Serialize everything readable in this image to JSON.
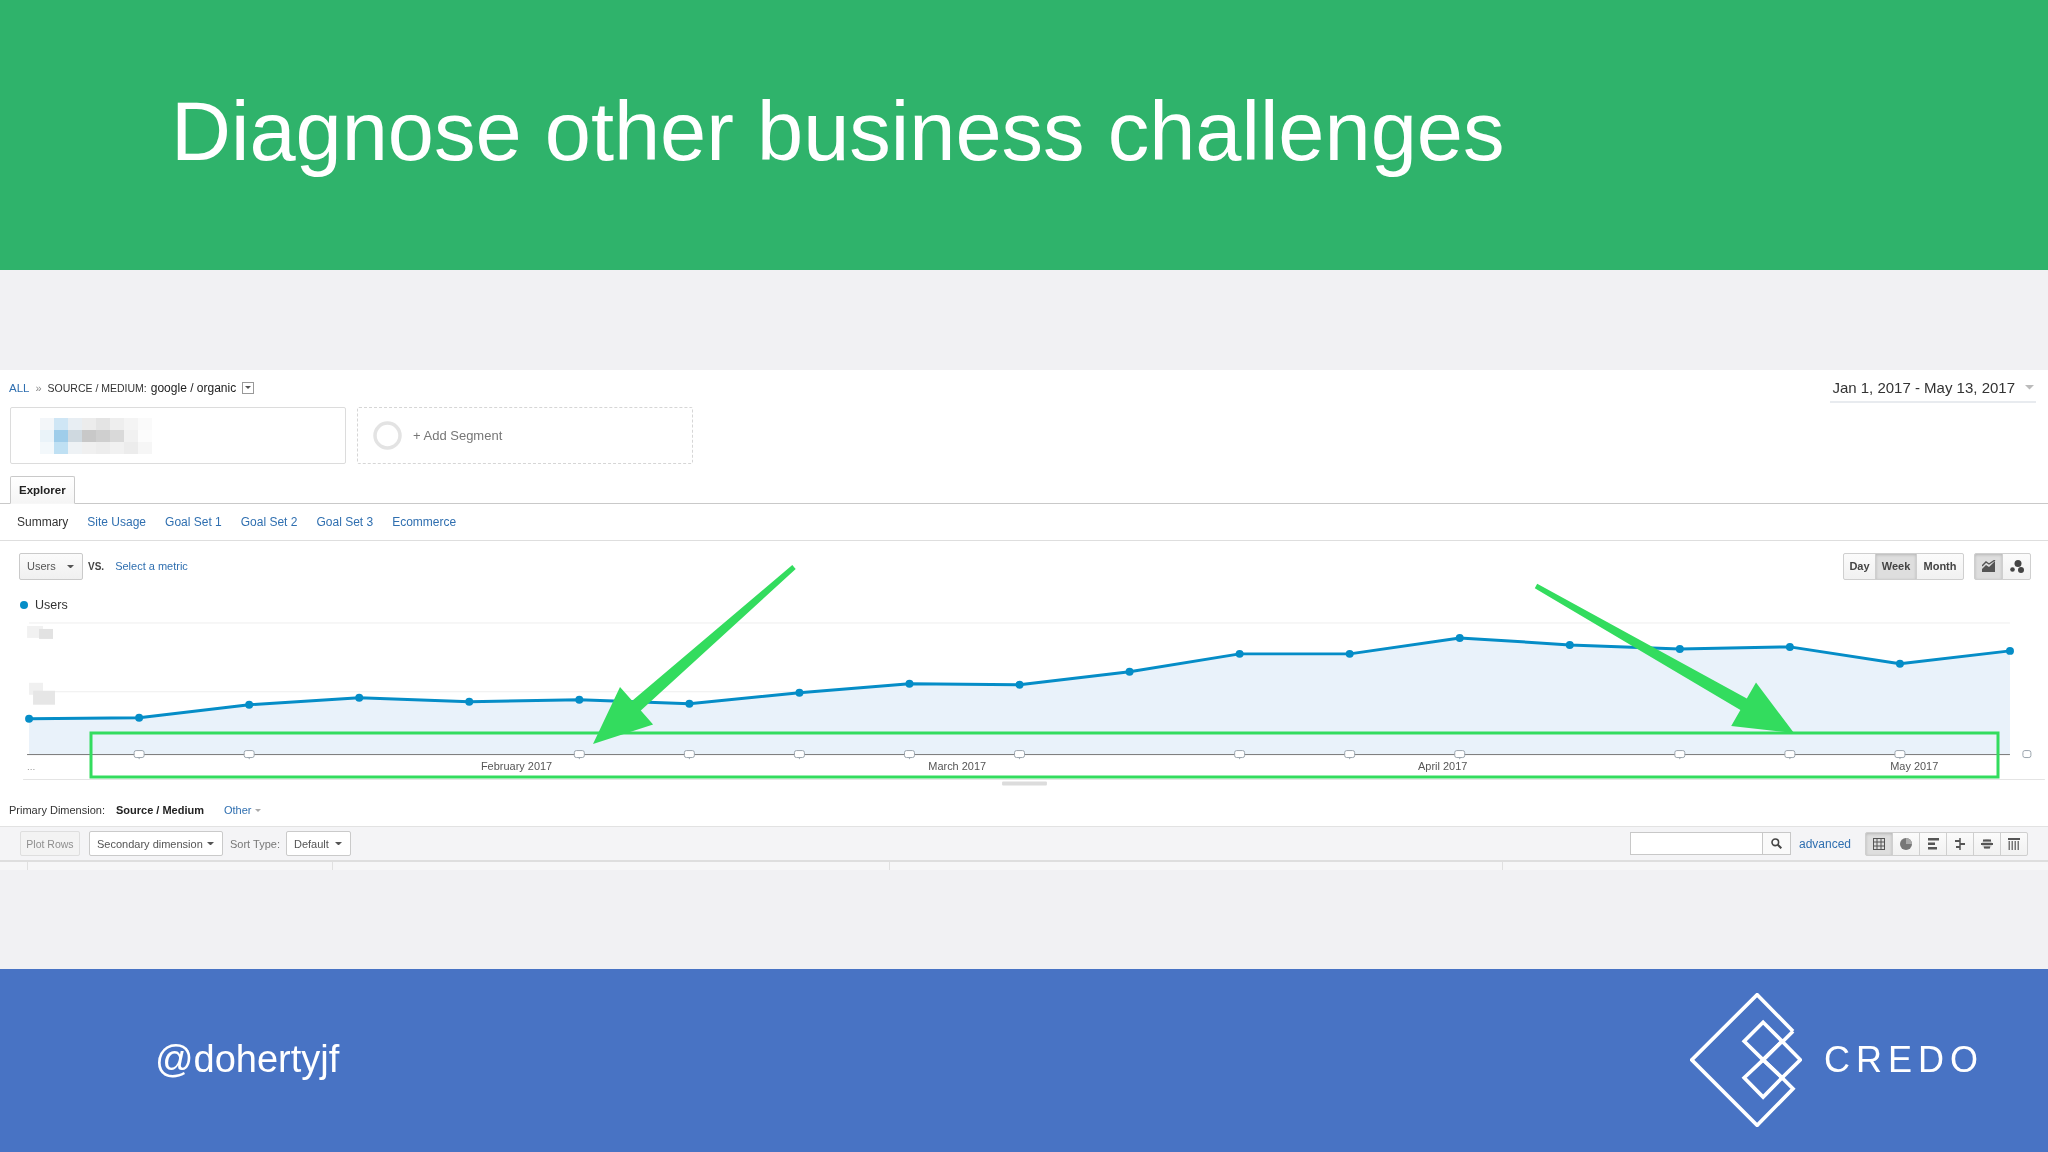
{
  "slide": {
    "title": "Diagnose other business challenges"
  },
  "report": {
    "breadcrumb": {
      "root": "ALL",
      "separator": "»",
      "field": "SOURCE / MEDIUM:",
      "value": "google / organic"
    },
    "date_range": "Jan 1, 2017 - May 13, 2017",
    "segments": [
      {
        "kind": "blurred"
      },
      {
        "kind": "add",
        "label": "+ Add Segment"
      }
    ],
    "tabs": [
      {
        "label": "Explorer",
        "selected": true
      }
    ],
    "subtabs": [
      {
        "label": "Summary",
        "selected": true
      },
      {
        "label": "Site Usage",
        "selected": false
      },
      {
        "label": "Goal Set 1",
        "selected": false
      },
      {
        "label": "Goal Set 2",
        "selected": false
      },
      {
        "label": "Goal Set 3",
        "selected": false
      },
      {
        "label": "Ecommerce",
        "selected": false
      }
    ],
    "metric": {
      "value": "Users",
      "vs": "VS.",
      "compare_link": "Select a metric"
    },
    "intervals": [
      {
        "label": "Day",
        "selected": false
      },
      {
        "label": "Week",
        "selected": true
      },
      {
        "label": "Month",
        "selected": false
      }
    ],
    "chart_types": [
      {
        "kind": "line",
        "selected": true
      },
      {
        "kind": "motion",
        "selected": false
      }
    ],
    "chart": {
      "legend": "Users",
      "start_label": "...",
      "month_labels": [
        "February 2017",
        "March 2017",
        "April 2017",
        "May 2017"
      ]
    },
    "primary_dimension": {
      "label": "Primary Dimension:",
      "value": "Source / Medium",
      "other": "Other"
    },
    "toolbar": {
      "plot_rows": {
        "label": "Plot Rows",
        "disabled": true
      },
      "secondary_dimension": "Secondary dimension",
      "sort_label": "Sort Type:",
      "sort_value": "Default",
      "advanced": "advanced",
      "views": [
        {
          "kind": "table",
          "selected": true
        },
        {
          "kind": "pie",
          "selected": false
        },
        {
          "kind": "performance",
          "selected": false
        },
        {
          "kind": "comparison",
          "selected": false
        },
        {
          "kind": "term_cloud",
          "selected": false
        },
        {
          "kind": "pivot",
          "selected": false
        }
      ]
    }
  },
  "footer": {
    "handle": "@dohertyjf",
    "brand": "CREDO"
  }
}
